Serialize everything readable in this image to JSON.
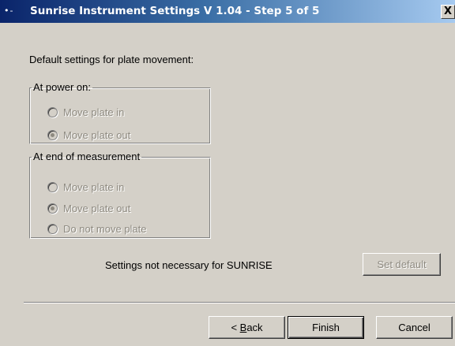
{
  "window": {
    "title": "Sunrise Instrument Settings V 1.04  -  Step 5 of 5",
    "close_label": "X",
    "icon": "app-system-menu-icon"
  },
  "intro_text": "Default settings for plate movement:",
  "power_on_group": {
    "legend": "At power on:",
    "options": [
      {
        "label": "Move plate in",
        "checked": false,
        "enabled": false
      },
      {
        "label": "Move plate out",
        "checked": true,
        "enabled": false
      }
    ]
  },
  "end_group": {
    "legend": "At end of measurement",
    "options": [
      {
        "label": "Move plate in",
        "checked": false,
        "enabled": false
      },
      {
        "label": "Move plate out",
        "checked": true,
        "enabled": false
      },
      {
        "label": "Do not move plate",
        "checked": false,
        "enabled": false
      }
    ]
  },
  "note_text": "Settings not necessary for SUNRISE",
  "buttons": {
    "set_default": "Set default",
    "back_mnemonic": "B",
    "back_rest": "ack",
    "back_prefix": "< ",
    "finish": "Finish",
    "cancel": "Cancel"
  },
  "colors": {
    "title_start": "#0a246a",
    "title_end": "#a6caf0",
    "face": "#d4d0c8",
    "disabled_text": "#8e8a80"
  }
}
